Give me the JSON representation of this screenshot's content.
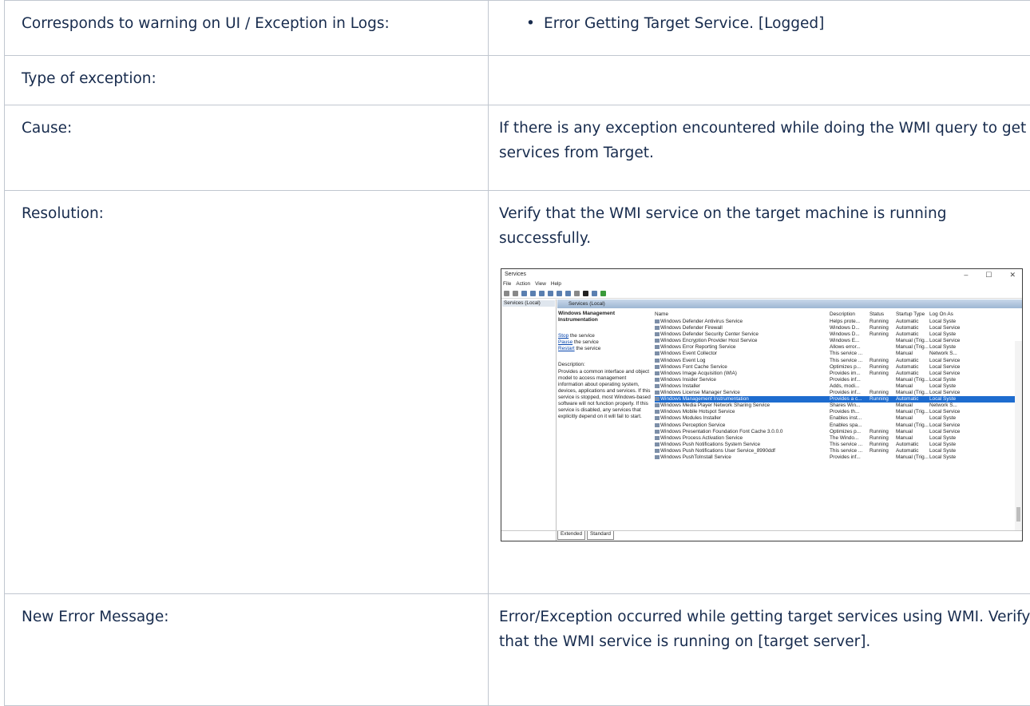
{
  "rows": {
    "warning": {
      "label": "Corresponds to warning on UI / Exception in Logs:",
      "bullet": "Error Getting Target Service. [Logged]"
    },
    "type": {
      "label": "Type of exception:",
      "value": ""
    },
    "cause": {
      "label": "Cause:",
      "value": "If there is any exception encountered while doing the WMI query to get services from Target."
    },
    "resolution": {
      "label": "Resolution:",
      "value": "Verify that the WMI service on the target machine is running successfully."
    },
    "new_error": {
      "label": "New Error Message:",
      "value": "Error/Exception occurred while getting target services using WMI. Verify that the WMI service is running on [target server]."
    }
  },
  "screenshot": {
    "title": "Services",
    "menu": [
      "File",
      "Action",
      "View",
      "Help"
    ],
    "tree_node": "Services (Local)",
    "panel_header": "Services (Local)",
    "desc_title": "Windows Management Instrumentation",
    "actions": {
      "stop": "Stop",
      "stop_rest": " the service",
      "pause": "Pause",
      "pause_rest": " the service",
      "restart": "Restart",
      "restart_rest": " the service"
    },
    "description_label": "Description:",
    "description_text": "Provides a common interface and object model to access management information about operating system, devices, applications and services. If this service is stopped, most Windows-based software will not function properly. If this service is disabled, any services that explicitly depend on it will fail to start.",
    "columns": [
      "Name",
      "Description",
      "Status",
      "Startup Type",
      "Log On As"
    ],
    "services": [
      [
        "Windows Defender Antivirus Service",
        "Helps prote...",
        "Running",
        "Automatic",
        "Local Syste"
      ],
      [
        "Windows Defender Firewall",
        "Windows D...",
        "Running",
        "Automatic",
        "Local Service"
      ],
      [
        "Windows Defender Security Center Service",
        "Windows D...",
        "Running",
        "Automatic",
        "Local Syste"
      ],
      [
        "Windows Encryption Provider Host Service",
        "Windows E...",
        "",
        "Manual (Trig...",
        "Local Service"
      ],
      [
        "Windows Error Reporting Service",
        "Allows error...",
        "",
        "Manual (Trig...",
        "Local Syste"
      ],
      [
        "Windows Event Collector",
        "This service ...",
        "",
        "Manual",
        "Network S..."
      ],
      [
        "Windows Event Log",
        "This service ...",
        "Running",
        "Automatic",
        "Local Service"
      ],
      [
        "Windows Font Cache Service",
        "Optimizes p...",
        "Running",
        "Automatic",
        "Local Service"
      ],
      [
        "Windows Image Acquisition (WIA)",
        "Provides im...",
        "Running",
        "Automatic",
        "Local Service"
      ],
      [
        "Windows Insider Service",
        "Provides inf...",
        "",
        "Manual (Trig...",
        "Local Syste"
      ],
      [
        "Windows Installer",
        "Adds, modi...",
        "",
        "Manual",
        "Local Syste"
      ],
      [
        "Windows License Manager Service",
        "Provides inf...",
        "Running",
        "Manual (Trig...",
        "Local Service"
      ],
      [
        "Windows Management Instrumentation",
        "Provides a c...",
        "Running",
        "Automatic",
        "Local Syste"
      ],
      [
        "Windows Media Player Network Sharing Service",
        "Shares Win...",
        "",
        "Manual",
        "Network S..."
      ],
      [
        "Windows Mobile Hotspot Service",
        "Provides th...",
        "",
        "Manual (Trig...",
        "Local Service"
      ],
      [
        "Windows Modules Installer",
        "Enables inst...",
        "",
        "Manual",
        "Local Syste"
      ],
      [
        "Windows Perception Service",
        "Enables spa...",
        "",
        "Manual (Trig...",
        "Local Service"
      ],
      [
        "Windows Presentation Foundation Font Cache 3.0.0.0",
        "Optimizes p...",
        "Running",
        "Manual",
        "Local Service"
      ],
      [
        "Windows Process Activation Service",
        "The Windo...",
        "Running",
        "Manual",
        "Local Syste"
      ],
      [
        "Windows Push Notifications System Service",
        "This service ...",
        "Running",
        "Automatic",
        "Local Syste"
      ],
      [
        "Windows Push Notifications User Service_8990ddf",
        "This service ...",
        "Running",
        "Automatic",
        "Local Syste"
      ],
      [
        "Windows PushToInstall Service",
        "Provides inf...",
        "",
        "Manual (Trig...",
        "Local Syste"
      ]
    ],
    "selected_index": 12,
    "tabs": [
      "Extended",
      "Standard"
    ],
    "window_controls": [
      "–",
      "☐",
      "✕"
    ]
  }
}
